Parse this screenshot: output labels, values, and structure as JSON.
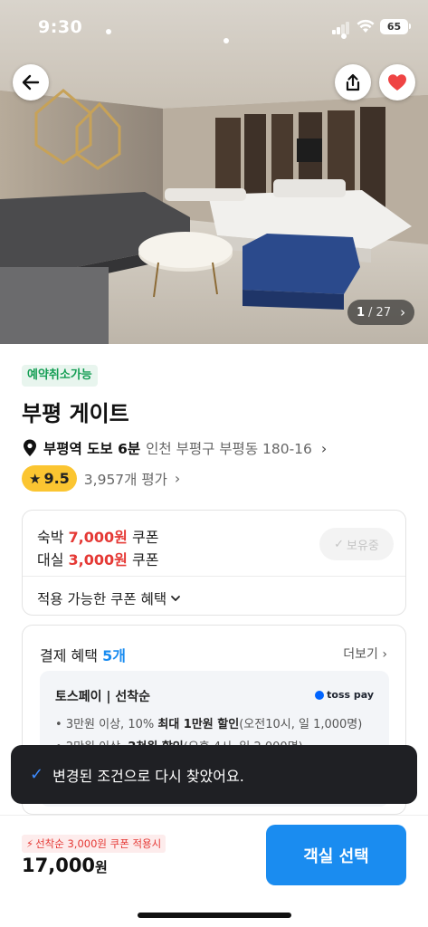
{
  "status_bar": {
    "time": "9:30",
    "battery": "65"
  },
  "hero": {
    "photo_current": "1",
    "photo_total": "/ 27",
    "icons": {
      "back": "arrow-left-icon",
      "share": "share-icon",
      "like": "heart-icon"
    },
    "like_color": "#ef4444"
  },
  "hotel": {
    "cancel_badge": "예약취소가능",
    "name": "부평 게이트",
    "walk": "부평역 도보 6분",
    "address": "인천 부평구 부평동 180-16",
    "rating": "9.5",
    "review_count": "3,957개 평가"
  },
  "coupon": {
    "line1_prefix": "숙박",
    "line1_amount": "7,000원",
    "line1_suffix": "쿠폰",
    "line2_prefix": "대실",
    "line2_amount": "3,000원",
    "line2_suffix": "쿠폰",
    "owned_label": "보유중",
    "benefits_label": "적용 가능한 쿠폰 혜택"
  },
  "payment": {
    "title": "결제 혜택",
    "count": "5개",
    "more": "더보기",
    "provider_title": "토스페이 | 선착순",
    "logo_text": "toss pay",
    "item1_pre": "3만원 이상, 10%",
    "item1_bold": "최대 1만원 할인",
    "item1_post": "(오전10시, 일 1,000명)",
    "item2_pre": "2만원 이상,",
    "item2_bold": "2천원 할인",
    "item2_post": "(오후 4시, 일 2,000명)"
  },
  "toast": {
    "message": "변경된 조건으로 다시 찾았어요."
  },
  "bottom": {
    "promo": "선착순 3,000원 쿠폰 적용시",
    "price": "17,000",
    "currency": "원",
    "cta": "객실 선택"
  },
  "colors": {
    "accent": "#1a8cf0",
    "discount": "#e53935",
    "rating": "#fbc531",
    "cancel_badge": "#149e54"
  }
}
